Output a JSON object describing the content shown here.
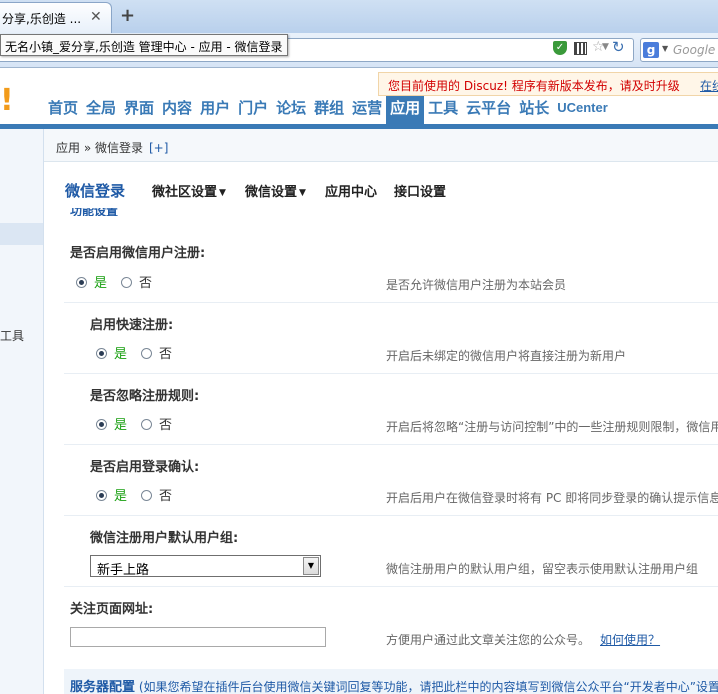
{
  "browser": {
    "tab_title": "分享,乐创造 ...",
    "tab_close": "✕",
    "new_tab": "+",
    "tooltip": "无名小镇_爱分享,乐创造 管理中心 - 应用 - 微信登录",
    "url": "",
    "search_placeholder": "Google",
    "search_engine_glyph": "g"
  },
  "header": {
    "notice_text": "您目前使用的 Discuz! 程序有新版本发布，请及时升级",
    "notice_link": "在线",
    "logo_glyph": "!",
    "nav": [
      "首页",
      "全局",
      "界面",
      "内容",
      "用户",
      "门户",
      "论坛",
      "群组",
      "运营",
      "应用",
      "工具",
      "云平台",
      "站长",
      "UCenter"
    ],
    "active_nav": "应用"
  },
  "sidebar": {
    "fragment_text": "工具"
  },
  "breadcrumb": {
    "text": "应用 » 微信登录",
    "add": "[+]"
  },
  "subnav": {
    "title": "微信登录",
    "items": [
      {
        "label": "微社区设置",
        "caret": "▼"
      },
      {
        "label": "微信设置",
        "caret": "▼"
      },
      {
        "label": "应用中心",
        "caret": ""
      },
      {
        "label": "接口设置",
        "caret": ""
      }
    ]
  },
  "section_title": "功能设置",
  "settings": [
    {
      "title": "是否启用微信用户注册:",
      "yes": "是",
      "no": "否",
      "selected": "yes",
      "hint": "是否允许微信用户注册为本站会员"
    },
    {
      "title": "启用快速注册:",
      "yes": "是",
      "no": "否",
      "selected": "yes",
      "hint": "开启后未绑定的微信用户将直接注册为新用户"
    },
    {
      "title": "是否忽略注册规则:",
      "yes": "是",
      "no": "否",
      "selected": "yes",
      "hint": "开启后将忽略“注册与访问控制”中的一些注册规则限制，微信用"
    },
    {
      "title": "是否启用登录确认:",
      "yes": "是",
      "no": "否",
      "selected": "yes",
      "hint": "开启后用户在微信登录时将有 PC 即将同步登录的确认提示信息"
    }
  ],
  "usergroup": {
    "title": "微信注册用户默认用户组:",
    "value": "新手上路",
    "hint": "微信注册用户的默认用户组，留空表示使用默认注册用户组"
  },
  "follow_url": {
    "title": "关注页面网址:",
    "value": "",
    "hint": "方便用户通过此文章关注您的公众号。",
    "link": "如何使用？"
  },
  "server": {
    "title": "服务器配置",
    "text": "(如果您希望在插件后台使用微信关键词回复等功能，请把此栏中的内容填写到微信公众平台“开发者中心”设置"
  },
  "colors": {
    "accent": "#3a7ab6",
    "notice_red": "#d20000",
    "yes_green": "#1aa012",
    "link_blue": "#1f5aa6"
  }
}
